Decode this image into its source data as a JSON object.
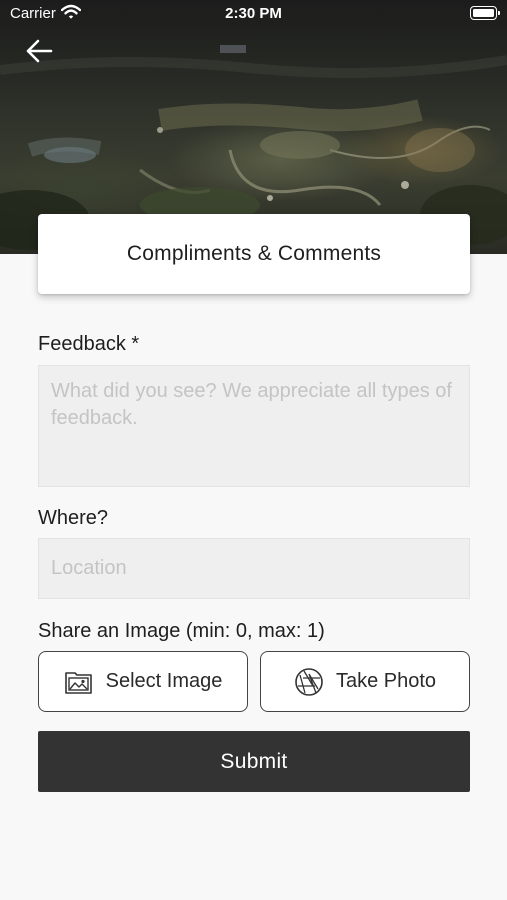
{
  "status_bar": {
    "carrier": "Carrier",
    "time": "2:30 PM"
  },
  "header": {
    "back_icon": "arrow-left-icon",
    "title": "Compliments & Comments"
  },
  "form": {
    "feedback_label": "Feedback *",
    "feedback_placeholder": "What did you see? We appreciate all types of feedback.",
    "feedback_value": "",
    "where_label": "Where?",
    "location_placeholder": "Location",
    "location_value": "",
    "share_label": "Share an Image (min: 0, max: 1)",
    "select_image_label": "Select Image",
    "select_image_icon": "image-gallery-icon",
    "take_photo_label": "Take Photo",
    "take_photo_icon": "camera-aperture-icon",
    "submit_label": "Submit"
  },
  "colors": {
    "background": "#f8f8f8",
    "field_background": "#efefef",
    "submit_background": "#333333",
    "text": "#1e1e1e"
  }
}
